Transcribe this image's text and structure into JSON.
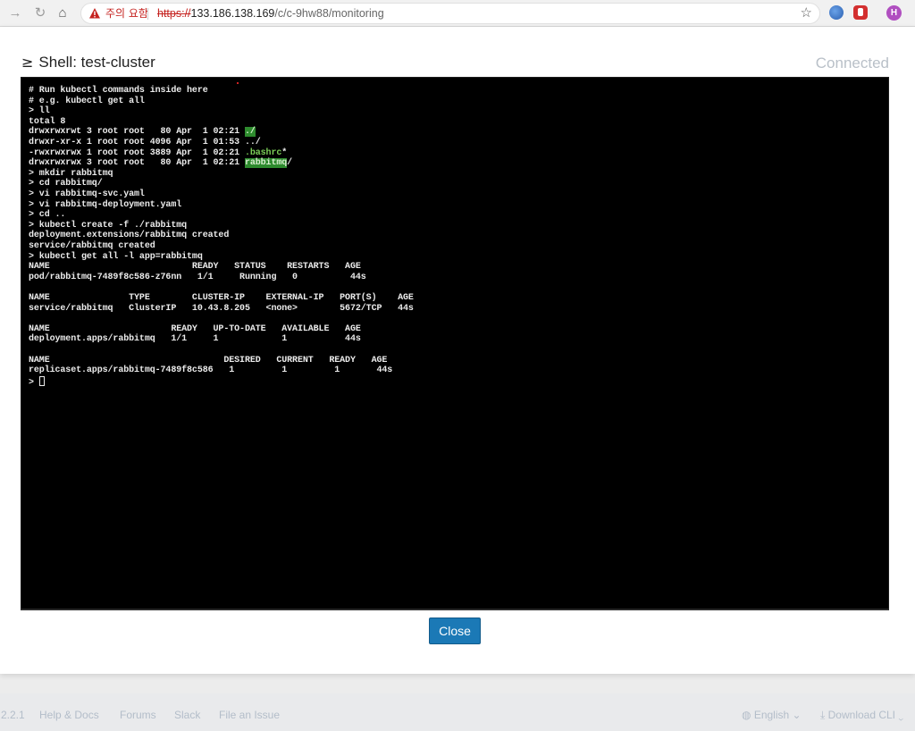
{
  "browser": {
    "security_warning": "주의 요함",
    "url_scheme": "https://",
    "url_host": "133.186.138.169",
    "url_path": "/c/c-9hw88/monitoring",
    "avatar_letter": "H"
  },
  "modal": {
    "title_icon": "≥",
    "title": "Shell: test-cluster",
    "status": "Connected",
    "close_label": "Close"
  },
  "terminal": {
    "lines": [
      "# Run kubectl commands inside here",
      "# e.g. kubectl get all",
      "> ll",
      "total 8",
      "drwxrwxrwt 3 root root   80 Apr  1 02:21 ",
      "drwxr-xr-x 1 root root 4096 Apr  1 01:53 ../",
      "-rwxrwxrwx 1 root root 3889 Apr  1 02:21 ",
      "drwxrwxrwx 3 root root   80 Apr  1 02:21 ",
      "> mkdir rabbitmq",
      "> cd rabbitmq/",
      "> vi rabbitmq-svc.yaml",
      "> vi rabbitmq-deployment.yaml",
      "> cd ..",
      "> kubectl create -f ./rabbitmq",
      "deployment.extensions/rabbitmq created",
      "service/rabbitmq created",
      "> kubectl get all -l app=rabbitmq",
      "NAME                           READY   STATUS    RESTARTS   AGE",
      "pod/rabbitmq-7489f8c586-z76nn   1/1     Running   0          44s",
      "",
      "NAME               TYPE        CLUSTER-IP    EXTERNAL-IP   PORT(S)    AGE",
      "service/rabbitmq   ClusterIP   10.43.8.205   <none>        5672/TCP   44s",
      "",
      "NAME                       READY   UP-TO-DATE   AVAILABLE   AGE",
      "deployment.apps/rabbitmq   1/1     1            1           44s",
      "",
      "NAME                                 DESIRED   CURRENT   READY   AGE",
      "replicaset.apps/rabbitmq-7489f8c586   1         1         1       44s",
      "> "
    ],
    "ls_entries": {
      "current_dir": "./",
      "bashrc": ".bashrc",
      "bashrc_suffix": "*",
      "rabbitmq_dir": "rabbitmq",
      "dir_suffix": "/"
    }
  },
  "footer": {
    "version": "2.2.1",
    "links": [
      "Help & Docs",
      "Forums",
      "Slack",
      "File an Issue"
    ],
    "language": "English",
    "download": "Download CLI"
  }
}
